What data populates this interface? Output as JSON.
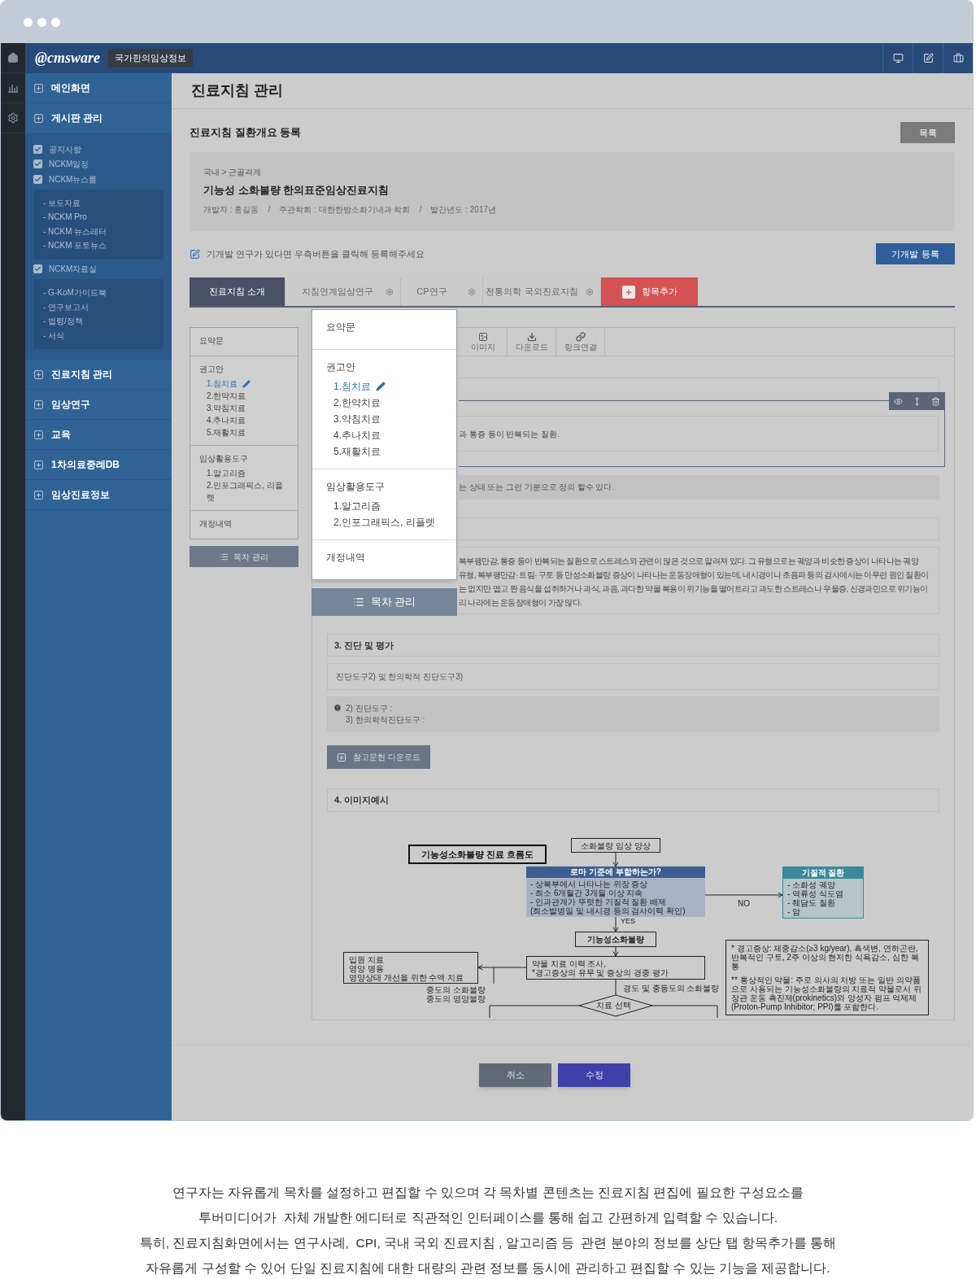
{
  "header": {
    "logo": "@cmsware",
    "site_badge": "국가한의임상정보"
  },
  "sidebar": {
    "items": [
      {
        "label": "메인화면"
      },
      {
        "label": "게시판 관리",
        "children": [
          {
            "label": "공지사항",
            "checked": true
          },
          {
            "label": "NCKM일정",
            "checked": true
          },
          {
            "label": "NCKM뉴스룸",
            "checked": true,
            "children": [
              {
                "label": "- 보도자료"
              },
              {
                "label": "- NCKM Pro"
              },
              {
                "label": "- NCKM 뉴스레터"
              },
              {
                "label": "- NCKM 포토뉴스"
              }
            ]
          },
          {
            "label": "NCKM자료실",
            "checked": true,
            "children": [
              {
                "label": "- G-KoM가이드북"
              },
              {
                "label": "- 연구보고서"
              },
              {
                "label": "- 법령/정책"
              },
              {
                "label": "- 서식"
              }
            ]
          }
        ]
      },
      {
        "label": "진료지침 관리"
      },
      {
        "label": "임상연구"
      },
      {
        "label": "교육"
      },
      {
        "label": "1차의료중례DB"
      },
      {
        "label": "임상진료정보"
      }
    ]
  },
  "page_title": "진료지침 관리",
  "section_title": "진료지침 질환개요 등록",
  "list_button": "목록",
  "guideline": {
    "breadcrumb": "국내 > 근골격계",
    "title": "기능성 소화불량 한의표준임상진료지침",
    "meta": "개발자 : 홍길동    /    주관학회 : 대한한방소화기내과 학회    /    발간년도 : 2017년"
  },
  "notice": "기개발 연구가 있다면 우측버튼을 클릭해 등록해주세요",
  "register_button": "기개발 등록",
  "tabs": [
    {
      "label": "진료지침 소개",
      "kind": "tab",
      "selected": true,
      "settings": false
    },
    {
      "label": "지침연계임상연구",
      "kind": "tab",
      "selected": false,
      "settings": true
    },
    {
      "label": "CP연구",
      "kind": "tab",
      "selected": false,
      "settings": true
    },
    {
      "label": "전통의학 국외진료지침",
      "kind": "tab",
      "selected": false,
      "settings": true
    },
    {
      "label": "항목추가",
      "kind": "add",
      "selected": false,
      "settings": false
    }
  ],
  "toc": {
    "sections": [
      {
        "title": "요약문"
      },
      {
        "title": "권고안",
        "items": [
          {
            "label": "1.침치료",
            "selected": true
          },
          {
            "label": "2.한약치료",
            "selected": false
          },
          {
            "label": "3.약침치료",
            "selected": false
          },
          {
            "label": "4.추나치료",
            "selected": false
          },
          {
            "label": "5.재활치료",
            "selected": false
          }
        ]
      },
      {
        "title": "임상활용도구",
        "items": [
          {
            "label": "1.알고리즘",
            "selected": false
          },
          {
            "label": "2.인포그래픽스, 리플렛",
            "selected": false
          }
        ]
      },
      {
        "title": "개정내역"
      }
    ],
    "button": "목차 관리"
  },
  "toc_popup": {
    "sections": [
      {
        "title": "요약문"
      },
      {
        "title": "권고안",
        "items": [
          {
            "label": "1.침치료",
            "selected": true
          },
          {
            "label": "2.한약치료",
            "selected": false
          },
          {
            "label": "3.약침치료",
            "selected": false
          },
          {
            "label": "4.추나치료",
            "selected": false
          },
          {
            "label": "5.재활치료",
            "selected": false
          }
        ]
      },
      {
        "title": "임상활용도구",
        "items": [
          {
            "label": "1.알고리즘",
            "selected": false
          },
          {
            "label": "2.인포그래픽스, 리플렛",
            "selected": false
          }
        ]
      },
      {
        "title": "개정내역"
      }
    ],
    "button": "목차 관리"
  },
  "editor": {
    "tools": [
      {
        "label": "이미지",
        "kind": "image"
      },
      {
        "label": "다운로드",
        "kind": "download"
      },
      {
        "label": "링크연결",
        "kind": "link"
      }
    ],
    "definition": "과 통증 등이 반복되는 질환.",
    "definition_note": "는 상태 또는 그런 기분으로 정의 할수 있다.",
    "description_lines": [
      "복부팽만감, 통증 등이 반복되는 질환으로 스트레스와 관련이 많은 것으로 알려져 있다. 그 유형으로는 궤양과 비슷한 증상이 나타나는 궤양",
      "유형, 복부팽만감· 트림· 구토 등 만성소화불량 증상이 나타나는 운동장애형이 있는데, 내시경이나 초음파 등의 검사에서는 아무런 원인 질환이",
      "는 없지만 맵고 짠 음식을 섭취하거나 과식, 과음, 과다한 약물 복용이 위기능을 떨어트리고 과도한 스트레스나 우울증, 신경과민으로 위기능이",
      "리 나라에는 운동장애형이 가장 많다."
    ],
    "section3_title": "3. 진단 및 평가",
    "section3_field": "진단도구2) 및 한의학적 진단도구3)",
    "section3_notes": [
      "2) 진단도구 :",
      "3) 한의학적진단도구 :"
    ],
    "reference_button": "참고문헌 다운로드",
    "section4_title": "4. 이미지예시"
  },
  "flowchart": {
    "title": "기능성소화불량 진료 흐름도",
    "start": "소화불량 임상 양상",
    "criteria": {
      "header": "로마 기준에 부합하는가?",
      "lines": [
        "-  상복부에서 나타나는 위장 증상",
        "-  최소 6개월간 3개월 이상 지속",
        "-  인과관계가 뚜렷한 기질적 질환 배제",
        "(최소발병일 및 내시경 등의 검사이력 확인)"
      ]
    },
    "no_label": "NO",
    "yes_label": "YES",
    "organic": {
      "header": "기질적 질환",
      "lines": [
        "-  소화성 궤양",
        "-  역류성 식도염",
        "-  췌담도 질환",
        "-  암"
      ]
    },
    "diagnosis": "기능성소화불량",
    "assessment": [
      "약물 치료 이력 조사,",
      "*경고증상의 유무 및 증상의 경중 평가"
    ],
    "severe_care": [
      "입원 치료",
      "영양 병용",
      "영양상태 개선을 위한 수액 치료"
    ],
    "severe_label": [
      "중도의 소화불량",
      "중도의 영양불량"
    ],
    "mild_label": "경도 및 중등도의 소화불량",
    "choice": "치료 선택",
    "notes": [
      "* 경고증상: 체중감소(≥3 kg/year), 흑색변, 연하곤란, 반복적인 구토, 2주 이상의 현저한 식욕감소, 심한 복통",
      "** 통상적인 약물: 주로 의사의 처방 또는 일반 의약품으로 사용되는 기능성소화불량의 치료적 약물로서 위장관 운동 촉진제(prokinetics)와 양성자 펌프 억제제(Proton-Pump Inhibitor; PPI)를 포함한다."
    ]
  },
  "actions": {
    "cancel": "취소",
    "save": "수정"
  },
  "caption": [
    "연구자는 자유롭게 목차를 설정하고 편집할 수 있으며 각 목차별 콘텐츠는 진료지침 편집에 필요한 구성요소를",
    "투버미디어가  자체 개발한 에디터로 직관적인 인터페이스를 통해 쉽고 간편하게 입력할 수 있습니다.",
    "특히, 진료지침화면에서는 연구사례,  CPI, 국내 국외 진료지침 , 알고리즘 등  관련 분야의 정보를 상단 탭 항목추가를 통해",
    "자유롭게 구성할 수 있어 단일 진료지침에 대한 대량의 관련 정보를 동시에 관리하고 편집할 수 있는 기능을 제공합니다."
  ]
}
